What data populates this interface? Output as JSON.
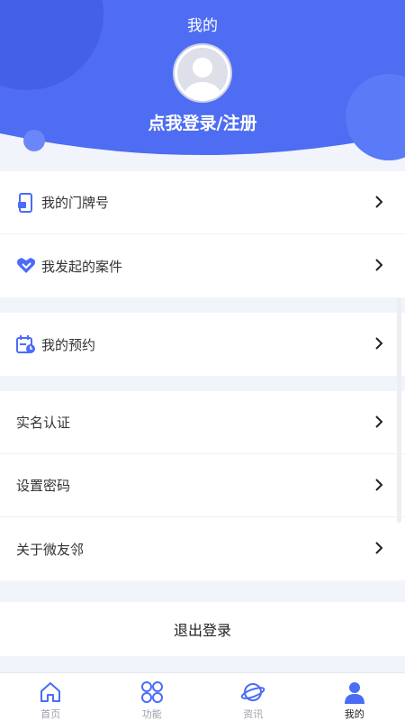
{
  "header": {
    "title": "我的",
    "login_text": "点我登录/注册",
    "accent_color": "#4a6cf7"
  },
  "menu_group_1": [
    {
      "label": "我的门牌号",
      "icon": "doorplate-phone-icon"
    },
    {
      "label": "我发起的案件",
      "icon": "heart-badge-icon"
    }
  ],
  "menu_group_2": [
    {
      "label": "我的预约",
      "icon": "calendar-clock-icon"
    }
  ],
  "menu_group_3": [
    {
      "label": "实名认证"
    },
    {
      "label": "设置密码"
    },
    {
      "label": "关于微友邻"
    }
  ],
  "logout_label": "退出登录",
  "tabbar": [
    {
      "label": "首页",
      "icon": "home-icon",
      "active": false
    },
    {
      "label": "功能",
      "icon": "grid-icon",
      "active": false
    },
    {
      "label": "资讯",
      "icon": "planet-icon",
      "active": false
    },
    {
      "label": "我的",
      "icon": "user-icon",
      "active": true
    }
  ]
}
